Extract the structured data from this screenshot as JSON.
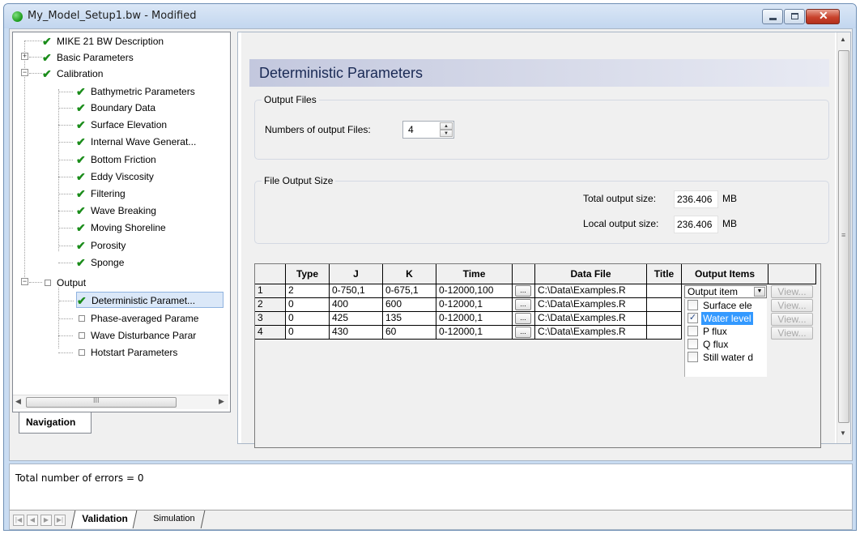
{
  "window": {
    "title": "My_Model_Setup1.bw - Modified"
  },
  "nav": {
    "items": [
      {
        "label": "MIKE 21 BW Description",
        "state": "check"
      },
      {
        "label": "Basic Parameters",
        "state": "check"
      },
      {
        "label": "Calibration",
        "state": "check"
      },
      {
        "label": "Bathymetric Parameters",
        "state": "check"
      },
      {
        "label": "Boundary Data",
        "state": "check"
      },
      {
        "label": "Surface Elevation",
        "state": "check"
      },
      {
        "label": "Internal Wave Generat...",
        "state": "check"
      },
      {
        "label": "Bottom Friction",
        "state": "check"
      },
      {
        "label": "Eddy Viscosity",
        "state": "check"
      },
      {
        "label": "Filtering",
        "state": "check"
      },
      {
        "label": "Wave Breaking",
        "state": "check"
      },
      {
        "label": "Moving Shoreline",
        "state": "check"
      },
      {
        "label": "Porosity",
        "state": "check"
      },
      {
        "label": "Sponge",
        "state": "check"
      },
      {
        "label": "Output",
        "state": "empty"
      },
      {
        "label": "Deterministic Paramet...",
        "state": "check"
      },
      {
        "label": "Phase-averaged Parame",
        "state": "empty"
      },
      {
        "label": "Wave Disturbance Parar",
        "state": "empty"
      },
      {
        "label": "Hotstart Parameters",
        "state": "empty"
      }
    ],
    "scroll_grip": "III",
    "tab": "Navigation"
  },
  "main": {
    "section_title": "Deterministic Parameters",
    "output_files": {
      "group_label": "Output Files",
      "count_label": "Numbers of output Files:",
      "count_value": "4"
    },
    "output_size": {
      "group_label": "File Output Size",
      "total_label": "Total output size:",
      "total_value": "236.406",
      "local_label": "Local output size:",
      "local_value": "236.406",
      "unit": "MB"
    },
    "table": {
      "headers": [
        "Type",
        "J",
        "K",
        "Time",
        "",
        "Data File",
        "Title",
        "Output Items"
      ],
      "rows": [
        {
          "num": "1",
          "type": "2",
          "j": "0-750,1",
          "k": "0-675,1",
          "time": "0-12000,100",
          "file": "C:\\Data\\Examples.R",
          "title": ""
        },
        {
          "num": "2",
          "type": "0",
          "j": "400",
          "k": "600",
          "time": "0-12000,1",
          "file": "C:\\Data\\Examples.R",
          "title": ""
        },
        {
          "num": "3",
          "type": "0",
          "j": "425",
          "k": "135",
          "time": "0-12000,1",
          "file": "C:\\Data\\Examples.R",
          "title": ""
        },
        {
          "num": "4",
          "type": "0",
          "j": "430",
          "k": "60",
          "time": "0-12000,1",
          "file": "C:\\Data\\Examples.R",
          "title": ""
        }
      ],
      "ellipsis_label": "...",
      "view_label": "View...",
      "output_item_select": "Output item",
      "output_item_options": [
        {
          "label": "Surface ele",
          "checked": false
        },
        {
          "label": "Water level",
          "checked": true
        },
        {
          "label": "P flux",
          "checked": false
        },
        {
          "label": "Q flux",
          "checked": false
        },
        {
          "label": "Still water d",
          "checked": false
        }
      ]
    }
  },
  "status": {
    "message": "Total number of errors = 0",
    "tabs": [
      "Validation",
      "Simulation"
    ]
  },
  "colors": {
    "check": "#1a8c1a",
    "title_bg": "#c3c8de",
    "selected_option": "#3399ff"
  }
}
